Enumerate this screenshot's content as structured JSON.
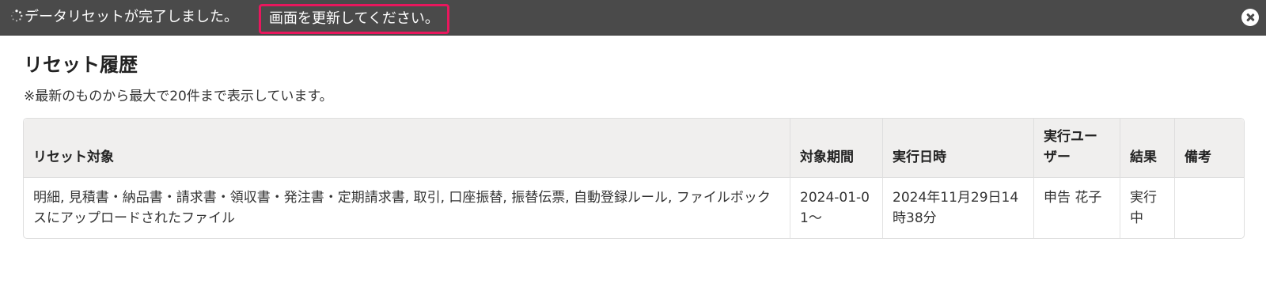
{
  "notification": {
    "message": "データリセットが完了しました。",
    "action_label": "画面を更新してください。",
    "icons": {
      "status": "loading-spinner-icon",
      "close": "close-circle-icon"
    }
  },
  "main": {
    "title": "リセット履歴",
    "note": "※最新のものから最大で20件まで表示しています。"
  },
  "table": {
    "headers": {
      "target": "リセット対象",
      "period": "対象期間",
      "executed_at": "実行日時",
      "user": "実行ユーザー",
      "result": "結果",
      "remarks": "備考"
    },
    "rows": [
      {
        "target": "明細, 見積書・納品書・請求書・領収書・発注書・定期請求書, 取引, 口座振替, 振替伝票, 自動登録ルール, ファイルボックスにアップロードされたファイル",
        "period": "2024-01-01～",
        "executed_at": "2024年11月29日14時38分",
        "user": "申告 花子",
        "result": "実行中",
        "remarks": ""
      }
    ]
  },
  "colors": {
    "notify_bg": "#4a4a4a",
    "highlight_border": "#e8175d",
    "header_bg": "#f0efee"
  }
}
